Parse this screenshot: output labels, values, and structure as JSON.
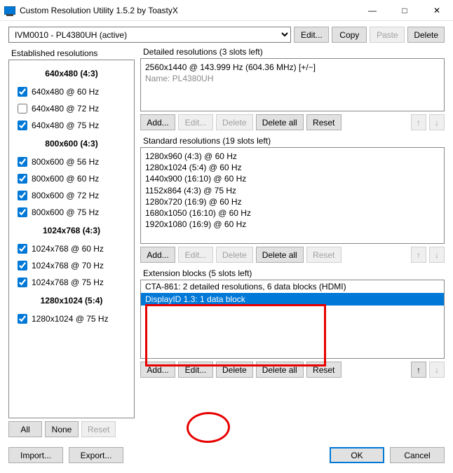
{
  "window": {
    "title": "Custom Resolution Utility 1.5.2 by ToastyX"
  },
  "toolbar": {
    "display_selected": "IVM0010 - PL4380UH (active)",
    "edit": "Edit...",
    "copy": "Copy",
    "paste": "Paste",
    "delete": "Delete"
  },
  "established": {
    "label": "Established resolutions",
    "categories": [
      {
        "heading": "640x480 (4:3)",
        "items": [
          {
            "label": "640x480 @ 60 Hz",
            "checked": true
          },
          {
            "label": "640x480 @ 72 Hz",
            "checked": false
          },
          {
            "label": "640x480 @ 75 Hz",
            "checked": true
          }
        ]
      },
      {
        "heading": "800x600 (4:3)",
        "items": [
          {
            "label": "800x600 @ 56 Hz",
            "checked": true
          },
          {
            "label": "800x600 @ 60 Hz",
            "checked": true
          },
          {
            "label": "800x600 @ 72 Hz",
            "checked": true
          },
          {
            "label": "800x600 @ 75 Hz",
            "checked": true
          }
        ]
      },
      {
        "heading": "1024x768 (4:3)",
        "items": [
          {
            "label": "1024x768 @ 60 Hz",
            "checked": true
          },
          {
            "label": "1024x768 @ 70 Hz",
            "checked": true
          },
          {
            "label": "1024x768 @ 75 Hz",
            "checked": true
          }
        ]
      },
      {
        "heading": "1280x1024 (5:4)",
        "items": [
          {
            "label": "1280x1024 @ 75 Hz",
            "checked": true
          }
        ]
      }
    ],
    "all": "All",
    "none": "None",
    "reset": "Reset"
  },
  "detailed": {
    "label": "Detailed resolutions (3 slots left)",
    "line1": "2560x1440 @ 143.999 Hz (604.36 MHz) [+/−]",
    "line2": "Name: PL4380UH",
    "add": "Add...",
    "edit": "Edit...",
    "delete": "Delete",
    "delete_all": "Delete all",
    "reset": "Reset"
  },
  "standard": {
    "label": "Standard resolutions (19 slots left)",
    "items": [
      "1280x960 (4:3) @ 60 Hz",
      "1280x1024 (5:4) @ 60 Hz",
      "1440x900 (16:10) @ 60 Hz",
      "1152x864 (4:3) @ 75 Hz",
      "1280x720 (16:9) @ 60 Hz",
      "1680x1050 (16:10) @ 60 Hz",
      "1920x1080 (16:9) @ 60 Hz"
    ],
    "add": "Add...",
    "edit": "Edit...",
    "delete": "Delete",
    "delete_all": "Delete all",
    "reset": "Reset"
  },
  "extblocks": {
    "label": "Extension blocks (5 slots left)",
    "items": [
      {
        "text": "CTA-861: 2 detailed resolutions, 6 data blocks (HDMI)",
        "selected": false
      },
      {
        "text": "DisplayID 1.3: 1 data block",
        "selected": true
      }
    ],
    "add": "Add...",
    "edit": "Edit...",
    "delete": "Delete",
    "delete_all": "Delete all",
    "reset": "Reset"
  },
  "bottom": {
    "import": "Import...",
    "export": "Export...",
    "ok": "OK",
    "cancel": "Cancel"
  },
  "arrows": {
    "up": "↑",
    "down": "↓"
  }
}
